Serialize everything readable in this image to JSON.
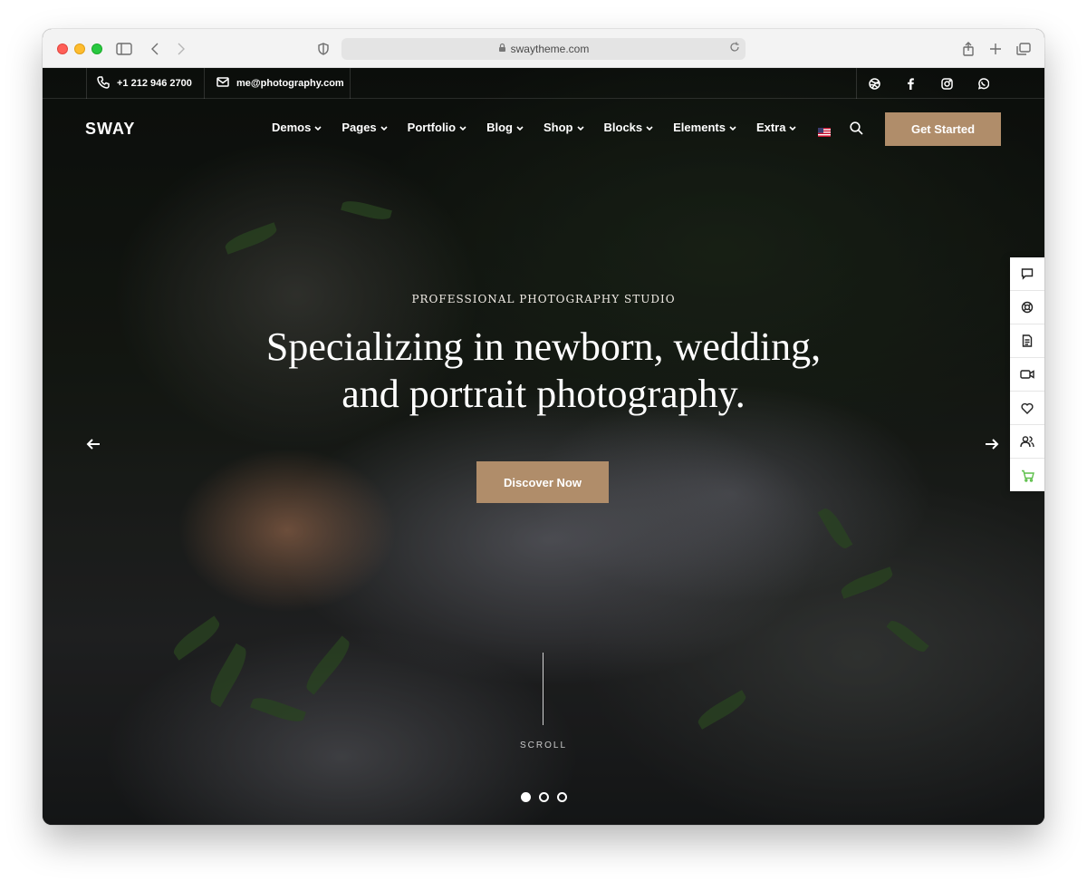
{
  "browser": {
    "url": "swaytheme.com"
  },
  "topbar": {
    "phone": "+1 212 946 2700",
    "email": "me@photography.com",
    "social": [
      "dribbble-icon",
      "facebook-icon",
      "instagram-icon",
      "whatsapp-icon"
    ]
  },
  "header": {
    "logo": "SWAY",
    "nav": [
      "Demos",
      "Pages",
      "Portfolio",
      "Blog",
      "Shop",
      "Blocks",
      "Elements",
      "Extra"
    ],
    "cta": "Get Started"
  },
  "hero": {
    "kicker": "PROFESSIONAL PHOTOGRAPHY STUDIO",
    "headline_line1": "Specializing in newborn, wedding,",
    "headline_line2": "and portrait photography.",
    "button": "Discover Now",
    "scroll": "SCROLL",
    "slides_total": 3,
    "slide_active": 1
  },
  "sidepanel": [
    "chat-icon",
    "support-icon",
    "document-icon",
    "video-icon",
    "heart-icon",
    "users-icon",
    "cart-icon"
  ],
  "colors": {
    "accent": "#b08d6a",
    "cart": "#5dbf4a"
  }
}
